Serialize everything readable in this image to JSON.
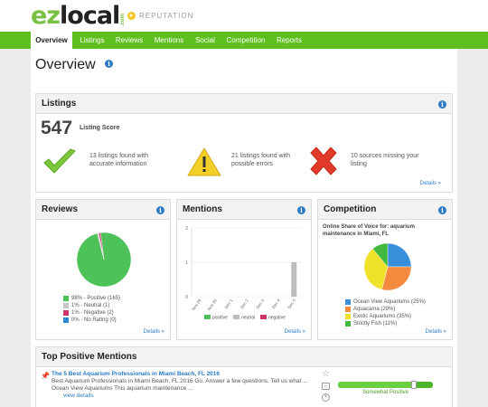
{
  "header": {
    "logo_ez": "ez",
    "logo_local": "local",
    "logo_com": ".com",
    "product": "REPUTATION"
  },
  "nav": [
    {
      "label": "Overview",
      "active": true
    },
    {
      "label": "Listings"
    },
    {
      "label": "Reviews"
    },
    {
      "label": "Mentions"
    },
    {
      "label": "Social"
    },
    {
      "label": "Competition"
    },
    {
      "label": "Reports"
    }
  ],
  "page_title": "Overview",
  "listings": {
    "title": "Listings",
    "score": "547",
    "score_label": "Listing Score",
    "items": [
      {
        "text": "13 listings found with accurate information",
        "icon": "check-icon"
      },
      {
        "text": "21 listings found with possible errors",
        "icon": "warning-icon"
      },
      {
        "text": "10 sources missing your listing",
        "icon": "x-icon"
      }
    ],
    "details": "Details »"
  },
  "reviews": {
    "title": "Reviews",
    "legend": [
      {
        "label": "98% - Positive (165)",
        "color": "#4cc259"
      },
      {
        "label": "1% - Neutral (1)",
        "color": "#c8c8c8"
      },
      {
        "label": "1% - Negative (2)",
        "color": "#d0336c"
      },
      {
        "label": "0% - No Rating (0)",
        "color": "#2a8ad6"
      }
    ],
    "details": "Details »"
  },
  "mentions": {
    "title": "Mentions",
    "details": "Details »"
  },
  "competition": {
    "title": "Competition",
    "subtitle": "Online Share of Voice for: aquarium maintenance in Miami, FL",
    "legend": [
      {
        "label": "Ocean View Aquariums (25%)",
        "color": "#3a8fdc"
      },
      {
        "label": "Aquacama (29%)",
        "color": "#f48a3e"
      },
      {
        "label": "Exotic Aquariums (35%)",
        "color": "#f0e22a"
      },
      {
        "label": "Strictly Fish (11%)",
        "color": "#42b83e"
      }
    ],
    "details": "Details »"
  },
  "top_mentions": {
    "title": "Top Positive Mentions",
    "item_title": "The 5 Best Aquarium Professionals in Miami Beach, FL 2016",
    "item_text": "Best Aquarium Professionals in Miami Beach, FL 2016 Go. Answer a few questions. Tell us what ... Ocean View Aquariums This aquarium maintenance ...",
    "view_details": "view details",
    "sentiment": "Somewhat Positive",
    "sentiment_level": 0.8
  },
  "chart_data": [
    {
      "type": "pie",
      "title": "",
      "categories": [
        "Positive",
        "Neutral",
        "Negative",
        "No Rating"
      ],
      "values": [
        98,
        1,
        1,
        0
      ],
      "colors": [
        "#4cc259",
        "#c8c8c8",
        "#d0336c",
        "#2a8ad6"
      ]
    },
    {
      "type": "bar",
      "title": "",
      "categories": [
        "Nov 29",
        "Nov 30",
        "Dec 1",
        "Dec 2",
        "Dec 3",
        "Dec 4",
        "Dec 5"
      ],
      "series": [
        {
          "name": "positive",
          "values": [
            0,
            0,
            0,
            0,
            0,
            0,
            0
          ],
          "color": "#4cc259"
        },
        {
          "name": "neutral",
          "values": [
            0,
            0,
            0,
            0,
            0,
            0,
            1
          ],
          "color": "#bdbdbd"
        },
        {
          "name": "negative",
          "values": [
            0,
            0,
            0,
            0,
            0,
            0,
            0
          ],
          "color": "#d0336c"
        }
      ],
      "yticks": [
        "0",
        "1",
        "2"
      ],
      "ylim": [
        0,
        2
      ],
      "legend_position": "bottom"
    },
    {
      "type": "pie",
      "title": "",
      "categories": [
        "Ocean View Aquariums",
        "Aquacama",
        "Exotic Aquariums",
        "Strictly Fish"
      ],
      "values": [
        25,
        29,
        35,
        11
      ],
      "colors": [
        "#3a8fdc",
        "#f48a3e",
        "#f0e22a",
        "#42b83e"
      ]
    }
  ]
}
